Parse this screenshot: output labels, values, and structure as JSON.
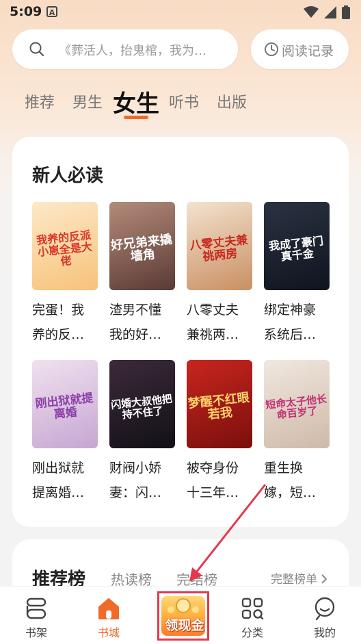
{
  "status_bar": {
    "time": "5:09",
    "notification_icon": "A"
  },
  "search": {
    "placeholder": "《葬活人，抬鬼棺，我为…"
  },
  "history_button": {
    "label": "阅读记录"
  },
  "tabs": [
    {
      "label": "推荐"
    },
    {
      "label": "男生"
    },
    {
      "label": "女生",
      "active": true
    },
    {
      "label": "听书"
    },
    {
      "label": "出版"
    }
  ],
  "new_reader": {
    "title": "新人必读",
    "books": [
      {
        "title_line1": "完蛋！我",
        "title_line2": "养的反…",
        "cover_text": "我养的反派小崽全是大佬",
        "cover_colors": [
          "#fde8c8",
          "#f7c27a"
        ],
        "cover_text_color": "#d8372c"
      },
      {
        "title_line1": "渣男不懂",
        "title_line2": "我的好…",
        "cover_text": "好兄弟来撬墙角",
        "cover_colors": [
          "#b58b7a",
          "#5a3a35"
        ],
        "cover_text_color": "#ffffff"
      },
      {
        "title_line1": "八零丈夫",
        "title_line2": "兼祧两…",
        "cover_text": "八零丈夫兼祧两房",
        "cover_colors": [
          "#f3e3d0",
          "#c98f62"
        ],
        "cover_text_color": "#c8281e"
      },
      {
        "title_line1": "绑定神豪",
        "title_line2": "系统后…",
        "cover_text": "我成了豪门真千金",
        "cover_colors": [
          "#2a3242",
          "#0f141e"
        ],
        "cover_text_color": "#ffffff"
      },
      {
        "title_line1": "刚出狱就",
        "title_line2": "提离婚…",
        "cover_text": "刚出狱就提离婚",
        "cover_colors": [
          "#efe1ef",
          "#c7a6d2"
        ],
        "cover_text_color": "#8b3fa8"
      },
      {
        "title_line1": "财阀小娇",
        "title_line2": "妻：闪…",
        "cover_text": "闪婚大叔他把持不住了",
        "cover_colors": [
          "#3c2a38",
          "#121018"
        ],
        "cover_text_color": "#ffffff"
      },
      {
        "title_line1": "被夺身份",
        "title_line2": "十三年…",
        "cover_text": "梦醒不红眼若我",
        "cover_colors": [
          "#c8261e",
          "#7a0f0c"
        ],
        "cover_text_color": "#ffd36a"
      },
      {
        "title_line1": "重生换",
        "title_line2": "嫁，短…",
        "cover_text": "短命太子他长命百岁了",
        "cover_colors": [
          "#f0e8e0",
          "#cfb9a8"
        ],
        "cover_text_color": "#c32f76"
      }
    ]
  },
  "ranking": {
    "title": "推荐榜",
    "tabs": [
      "热读榜",
      "完结榜"
    ],
    "more": "完整榜单"
  },
  "cash_button": {
    "label": "领现金"
  },
  "bottom_nav": [
    {
      "label": "书架",
      "icon": "bookshelf-icon"
    },
    {
      "label": "书城",
      "icon": "store-icon",
      "active": true
    },
    {
      "label": "分类",
      "icon": "category-icon"
    },
    {
      "label": "我的",
      "icon": "profile-icon"
    }
  ],
  "colors": {
    "accent": "#f06a2a",
    "highlight_box": "#e5384d",
    "arrow": "#e5384d"
  }
}
